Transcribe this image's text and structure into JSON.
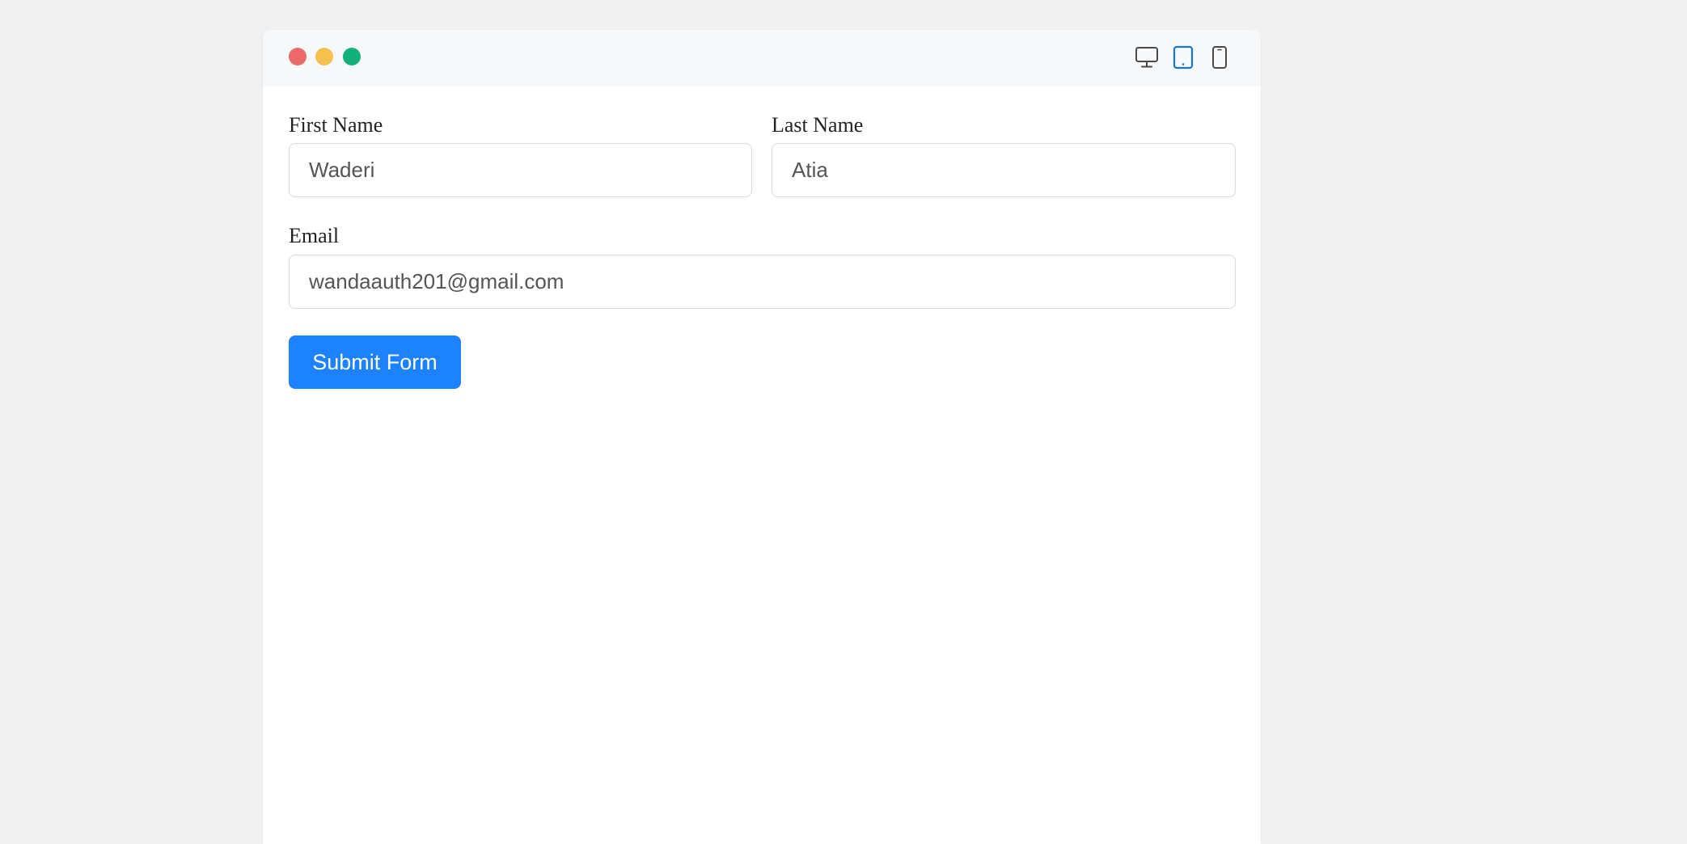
{
  "colors": {
    "close": "#ec6a6a",
    "minimize": "#f5c04e",
    "maximize": "#12b07a",
    "accent": "#1c82ff",
    "device_icon": "#4a4a4a",
    "device_icon_active": "#1a74d6"
  },
  "toolbar": {
    "devices": [
      {
        "name": "desktop",
        "icon": "desktop-icon",
        "active": false
      },
      {
        "name": "tablet",
        "icon": "tablet-icon",
        "active": true
      },
      {
        "name": "mobile",
        "icon": "mobile-icon",
        "active": false
      }
    ]
  },
  "form": {
    "first_name": {
      "label": "First Name",
      "value": "Waderi"
    },
    "last_name": {
      "label": "Last Name",
      "value": "Atia"
    },
    "email": {
      "label": "Email",
      "value": "wandaauth201@gmail.com"
    },
    "submit_label": "Submit Form"
  }
}
